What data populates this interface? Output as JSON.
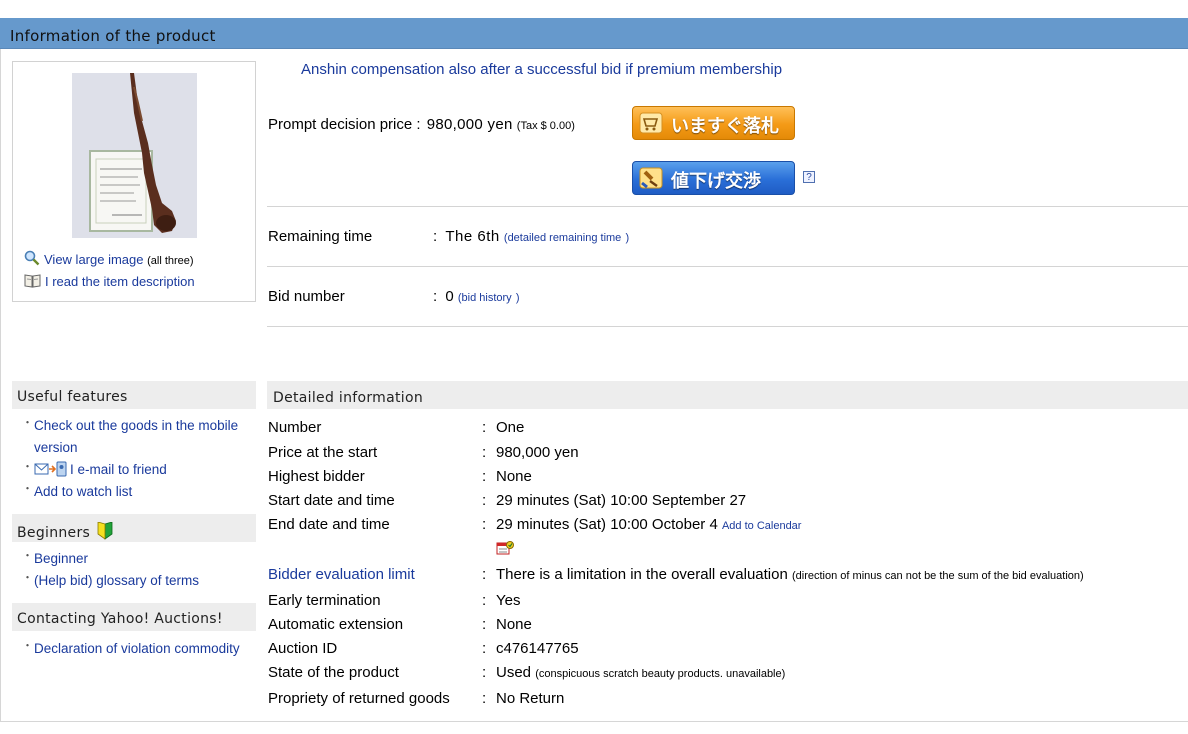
{
  "header": {
    "title": "Information of the product"
  },
  "image_panel": {
    "view_large_label": "View large image",
    "view_large_count": "(all three)",
    "read_description_label": "I read the item description"
  },
  "anshin_text": "Anshin compensation also after a successful bid if premium membership",
  "price": {
    "label": "Prompt decision price",
    "colon": ":",
    "value": "980,000 yen",
    "tax": "(Tax $ 0.00)",
    "buy_now_button": "いますぐ落札",
    "negotiate_button": "値下げ交渉",
    "help_icon_text": "?"
  },
  "remaining": {
    "label": "Remaining time",
    "colon": ":",
    "value": "The 6th",
    "open": "(",
    "link": "detailed remaining time",
    "close": ")"
  },
  "bids": {
    "label": "Bid number",
    "colon": ":",
    "value": "0",
    "open": "(",
    "link": "bid history",
    "close": ")"
  },
  "sidebar": {
    "useful_title": "Useful features",
    "useful_items": [
      "Check out the goods in the mobile version",
      "I e-mail to friend",
      "Add to watch list"
    ],
    "beginners_title": "Beginners",
    "beginner_items": [
      "Beginner",
      "(Help bid) glossary of terms"
    ],
    "contact_title": "Contacting Yahoo! Auctions!",
    "contact_items": [
      "Declaration of violation commodity"
    ]
  },
  "details": {
    "title": "Detailed information",
    "colon": ":",
    "rows": [
      {
        "label": "Number",
        "value": "One"
      },
      {
        "label": "Price at the start",
        "value": "980,000 yen"
      },
      {
        "label": "Highest bidder",
        "value": "None"
      },
      {
        "label": "Start date and time",
        "value": "29 minutes (Sat) 10:00 September 27"
      },
      {
        "label": "End date and time",
        "value": "29 minutes (Sat) 10:00 October 4",
        "link": "Add to Calendar"
      },
      {
        "label": "Bidder evaluation limit",
        "value": "There is a limitation in the overall evaluation",
        "note": "(direction of minus can not be the sum of the bid evaluation)"
      },
      {
        "label": "Early termination",
        "value": "Yes"
      },
      {
        "label": "Automatic extension",
        "value": "None"
      },
      {
        "label": "Auction ID",
        "value": "c476147765"
      },
      {
        "label": "State of the product",
        "value": "Used",
        "note": "(conspicuous scratch beauty products. unavailable)"
      },
      {
        "label": "Propriety of returned goods",
        "value": "No Return"
      }
    ]
  },
  "colors": {
    "title_bar": "#6699cc",
    "link": "#1a3a9c",
    "buy_now": "#f49a16",
    "negotiate": "#2a6fd8",
    "section_bg": "#ededed"
  }
}
